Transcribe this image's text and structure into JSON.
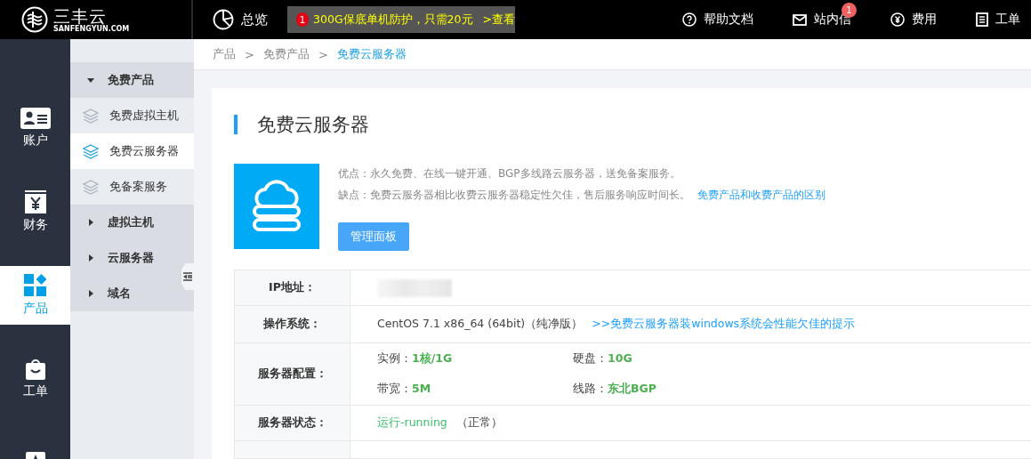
{
  "topbar": {
    "logo": {
      "name": "三丰云",
      "domain": "SANFENGYUN.COM"
    },
    "overview": "总览",
    "promo": {
      "badge": "1",
      "text": "300G保底单机防护，只需20元",
      "link": ">查看"
    },
    "links": [
      {
        "kind": "help",
        "label": "帮助文档"
      },
      {
        "kind": "mail",
        "label": "站内信",
        "badge": "1"
      },
      {
        "kind": "fee",
        "label": "费用"
      },
      {
        "kind": "ticket",
        "label": "工单"
      }
    ]
  },
  "rail": [
    {
      "kind": "account",
      "label": "账户",
      "selected": false
    },
    {
      "kind": "finance",
      "label": "财务",
      "selected": false
    },
    {
      "kind": "product",
      "label": "产品",
      "selected": true
    },
    {
      "kind": "ticket",
      "label": "工单",
      "selected": false
    },
    {
      "kind": "star",
      "selected": false
    }
  ],
  "submenu": [
    {
      "label": "免费产品",
      "expanded": true,
      "children": [
        {
          "label": "免费虚拟主机",
          "selected": false
        },
        {
          "label": "免费云服务器",
          "selected": true
        },
        {
          "label": "免备案服务",
          "selected": false
        }
      ]
    },
    {
      "label": "虚拟主机",
      "expanded": false
    },
    {
      "label": "云服务器",
      "expanded": false
    },
    {
      "label": "域名",
      "expanded": false
    }
  ],
  "breadcrumb": [
    {
      "label": "产品"
    },
    {
      "separator": ">",
      "label": "免费产品"
    },
    {
      "separator": ">",
      "label": "免费云服务器"
    }
  ],
  "product": {
    "title": "免费云服务器",
    "pros": "优点：永久免费、在线一键开通、BGP多线路云服务器，送免备案服务。",
    "cons": "缺点：免费云服务器相比收费云服务器稳定性欠佳，售后服务响应时间长。",
    "cons_link": "免费产品和收费产品的区别",
    "button": "管理面板"
  },
  "details": [
    {
      "kind": "redacted",
      "label": "IP地址："
    },
    {
      "kind": "os",
      "label": "操作系统：",
      "value": "CentOS 7.1 x86_64 (64bit)（纯净版）",
      "link": ">>免费云服务器装windows系统会性能欠佳的提示"
    },
    {
      "kind": "specs",
      "label": "服务器配置：",
      "specs": [
        {
          "name": "实例：",
          "value": "1核/1G"
        },
        {
          "name": "硬盘：",
          "value": "10G"
        },
        {
          "name": "带宽：",
          "value": "5M"
        },
        {
          "name": "线路：",
          "value": "东北BGP"
        }
      ]
    },
    {
      "kind": "status",
      "label": "服务器状态：",
      "value": "运行-running",
      "note": "（正常）"
    }
  ]
}
